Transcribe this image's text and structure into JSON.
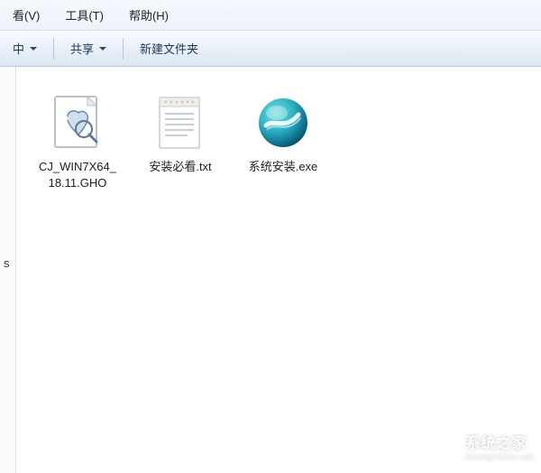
{
  "menu": {
    "view": "看(V)",
    "tools": "工具(T)",
    "help": "帮助(H)"
  },
  "toolbar": {
    "include": "中",
    "share": "共享",
    "new_folder": "新建文件夹"
  },
  "sidebar": {
    "fragment": "s"
  },
  "files": [
    {
      "name": "CJ_WIN7X64_18.11.GHO",
      "icon": "gho"
    },
    {
      "name": "安装必看.txt",
      "icon": "txt"
    },
    {
      "name": "系统安装.exe",
      "icon": "exe"
    }
  ],
  "watermark": {
    "title": "系统之家",
    "subtitle": "xitongzhijia.net"
  }
}
